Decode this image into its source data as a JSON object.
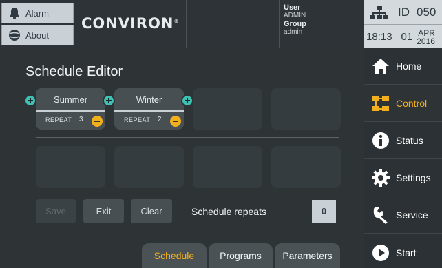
{
  "header": {
    "alarm_label": "Alarm",
    "about_label": "About",
    "logo_text": "CONVIRON",
    "logo_mark": "®",
    "user_label": "User",
    "user_value": "ADMIN",
    "group_label": "Group",
    "group_value": "admin"
  },
  "status": {
    "id_label": "ID",
    "id_value": "050",
    "time": "18:13",
    "day": "01",
    "month": "APR",
    "year": "2016"
  },
  "sidebar": {
    "items": [
      {
        "label": "Home",
        "icon": "home-icon"
      },
      {
        "label": "Control",
        "icon": "control-icon",
        "active": true
      },
      {
        "label": "Status",
        "icon": "info-icon"
      },
      {
        "label": "Settings",
        "icon": "gear-icon"
      },
      {
        "label": "Service",
        "icon": "wrench-icon"
      },
      {
        "label": "Start",
        "icon": "play-icon"
      }
    ]
  },
  "main": {
    "title": "Schedule Editor",
    "programs": [
      {
        "name": "Summer",
        "repeat_label": "REPEAT",
        "repeat_count": "3"
      },
      {
        "name": "Winter",
        "repeat_label": "REPEAT",
        "repeat_count": "2"
      }
    ],
    "buttons": {
      "save": "Save",
      "exit": "Exit",
      "clear": "Clear"
    },
    "repeats_label": "Schedule repeats",
    "repeats_value": "0",
    "tabs": [
      {
        "label": "Schedule",
        "active": true
      },
      {
        "label": "Programs"
      },
      {
        "label": "Parameters"
      }
    ]
  },
  "colors": {
    "accent": "#f2b01e",
    "add": "#3ec0b2",
    "background": "#2e3436"
  }
}
